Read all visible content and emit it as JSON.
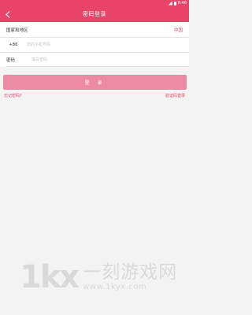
{
  "status_bar": {
    "time": "8:46"
  },
  "nav": {
    "title": "密码登录"
  },
  "form": {
    "region_label": "国家和地区",
    "region_value": "中国",
    "phone_prefix": "+86",
    "phone_placeholder": "您的手机号码",
    "password_label": "密码",
    "password_placeholder": "填写密码"
  },
  "login_button": "登 录",
  "links": {
    "forgot_password": "忘记密码?",
    "code_login": "验证码登录"
  },
  "watermark": {
    "logo": "1kx",
    "text_cn": "一刻游戏网",
    "url": "www.1kyx.com"
  },
  "colors": {
    "accent": "#e8446a",
    "button_disabled": "#eb8aa2",
    "background": "#f3f3f3"
  },
  "icons": {
    "back": "chevron-left-icon",
    "signal": "signal-icon",
    "battery": "battery-icon"
  }
}
